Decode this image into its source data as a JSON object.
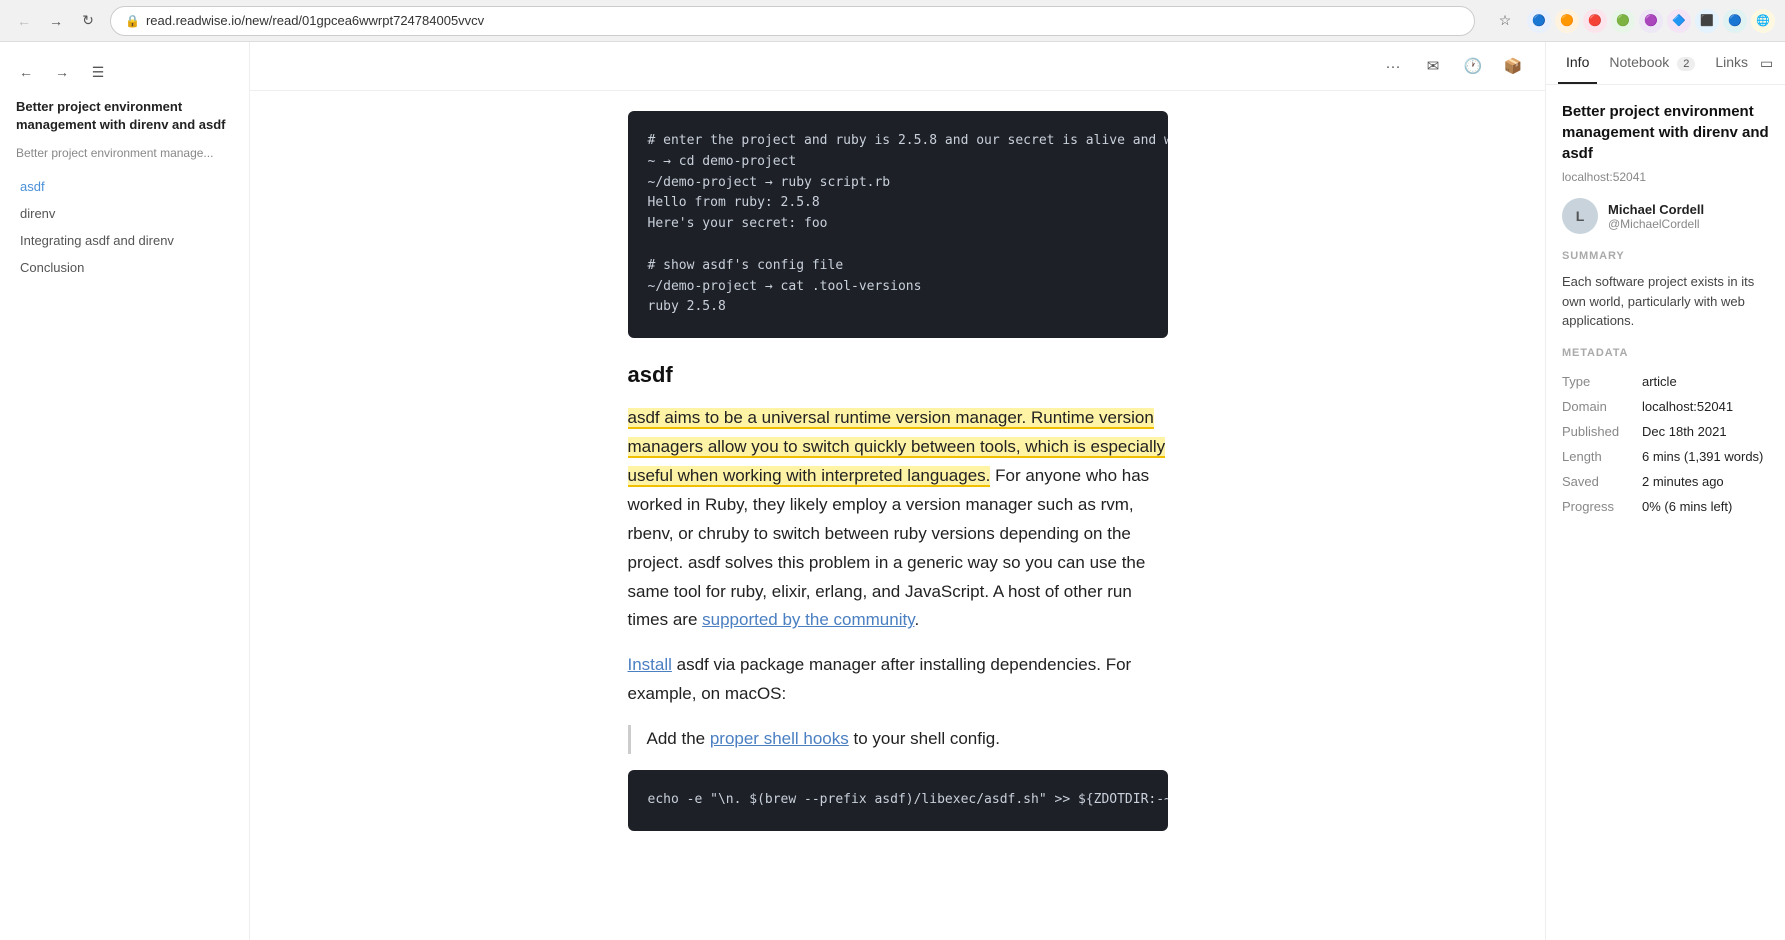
{
  "browser": {
    "back_disabled": true,
    "forward_enabled": true,
    "url": "read.readwise.io/new/read/01gpcea6wwrpt724784005vvcv",
    "url_display": "read.readwise.io/new/read/01gpcea6wwrpt724784005vvcv"
  },
  "sidebar": {
    "title": "Better project environment management with direnv and asdf",
    "subtitle": "Better project environment manage...",
    "toc": [
      {
        "label": "asdf",
        "active": true
      },
      {
        "label": "direnv",
        "active": false
      },
      {
        "label": "Integrating asdf and direnv",
        "active": false
      },
      {
        "label": "Conclusion",
        "active": false
      }
    ]
  },
  "content": {
    "code_block_1": "# enter the project and ruby is 2.5.8 and our secret is alive and well\n~ → cd demo-project\n~/demo-project → ruby script.rb\nHello from ruby: 2.5.8\nHere's your secret: foo\n\n# show asdf's config file\n~/demo-project → cat .tool-versions\nruby 2.5.8",
    "section_heading": "asdf",
    "paragraph_before_highlight": "",
    "highlight_text": "asdf aims to be a universal runtime version manager. Runtime version managers allow you to switch quickly between tools, which is especially useful when working with interpreted languages.",
    "paragraph_after_highlight": " For anyone who has worked in Ruby, they likely employ a version manager such as rvm, rbenv, or chruby to switch between ruby versions depending on the project. asdf solves this problem in a generic way so you can use the same tool for ruby, elixir, erlang, and JavaScript. A host of other run times are ",
    "community_link": "supported by the community",
    "paragraph_end": ".",
    "install_para_start": "",
    "install_link": "Install",
    "install_para_rest": " asdf via package manager after installing dependencies. For example, on macOS:",
    "blockquote_text_start": "Add the ",
    "shell_hooks_link": "proper shell hooks",
    "blockquote_text_end": " to your shell config.",
    "code_block_2": "echo -e \"\\n. $(brew --prefix asdf)/libexec/asdf.sh\" >> ${ZDOTDIR:-~}/.zs"
  },
  "info_panel": {
    "tabs": [
      {
        "label": "Info",
        "active": true,
        "badge": null
      },
      {
        "label": "Notebook",
        "active": false,
        "badge": "2"
      },
      {
        "label": "Links",
        "active": false,
        "badge": null
      }
    ],
    "article_title": "Better project environment management with direnv and asdf",
    "url": "localhost:52041",
    "author_initials": "L",
    "author_name": "Michael Cordell",
    "author_handle": "@MichaelCordell",
    "summary_label": "SUMMARY",
    "summary_text": "Each software project exists in its own world, particularly with web applications.",
    "metadata_label": "METADATA",
    "metadata": {
      "type_label": "Type",
      "type_value": "article",
      "domain_label": "Domain",
      "domain_value": "localhost:52041",
      "published_label": "Published",
      "published_value": "Dec 18th 2021",
      "length_label": "Length",
      "length_value": "6 mins (1,391 words)",
      "saved_label": "Saved",
      "saved_value": "2 minutes ago",
      "progress_label": "Progress",
      "progress_value": "0% (6 mins left)"
    }
  }
}
